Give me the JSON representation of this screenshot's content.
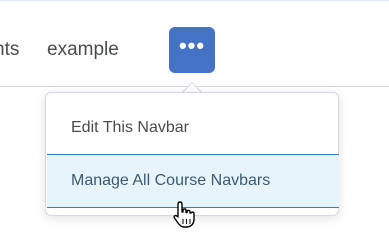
{
  "nav": {
    "partial_label": "nts",
    "example_label": "example",
    "more_button_glyph": "•••"
  },
  "menu": {
    "edit_label": "Edit This Navbar",
    "manage_label": "Manage All Course Navbars"
  },
  "colors": {
    "accent": "#4472c4",
    "hover_bg": "#e8f4fb",
    "hover_border": "#3a7fb8",
    "text": "#494c4e"
  },
  "icons": {
    "more": "ellipsis-icon",
    "cursor": "hand-pointer-icon"
  }
}
